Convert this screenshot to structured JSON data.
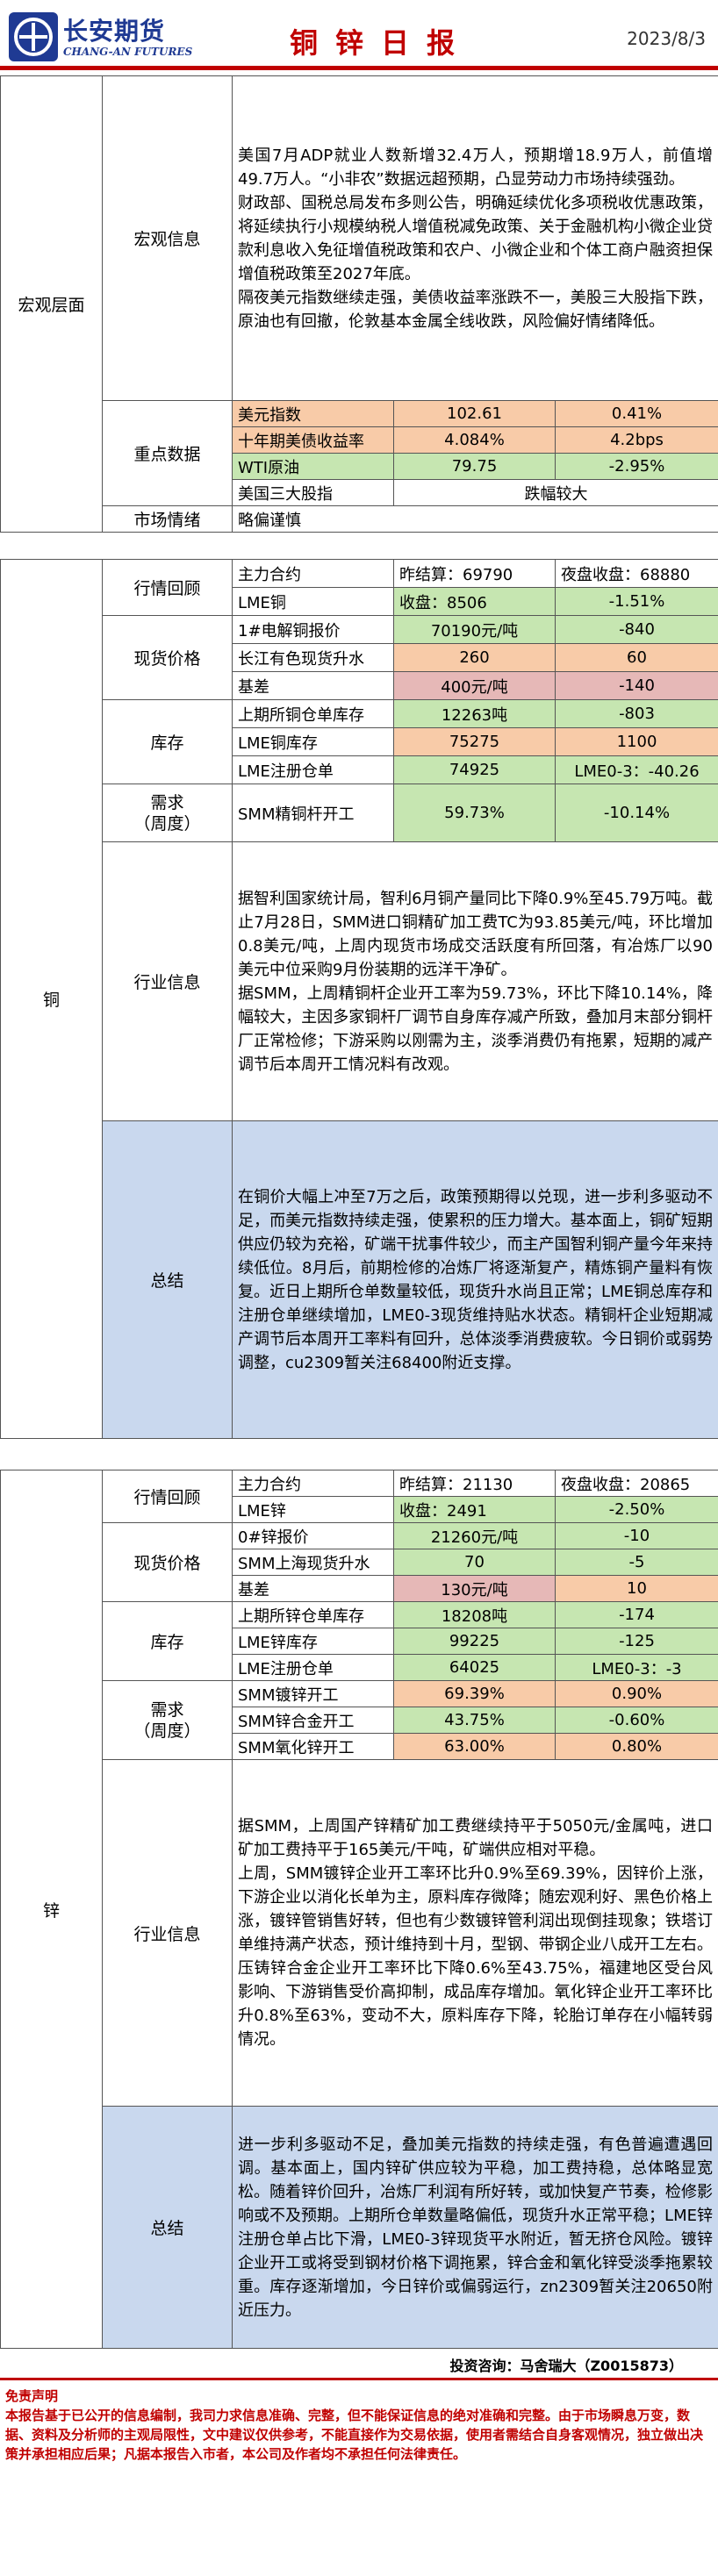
{
  "header": {
    "brand_cn": "长安期货",
    "brand_en": "CHANG-AN FUTURES",
    "title": "铜锌日报",
    "date": "2023/8/3"
  },
  "macro": {
    "section": "宏观层面",
    "info_label": "宏观信息",
    "info_text": "美国7月ADP就业人数新增32.4万人，预期增18.9万人，前值增49.7万人。“小非农”数据远超预期，凸显劳动力市场持续强劲。\n财政部、国税总局发布多则公告，明确延续优化多项税收优惠政策，将延续执行小规模纳税人增值税减免政策、关于金融机构小微企业贷款利息收入免征增值税政策和农户、小微企业和个体工商户融资担保增值税政策至2027年底。\n隔夜美元指数继续走强，美债收益率涨跌不一，美股三大股指下跌，原油也有回撤，伦敦基本金属全线收跌，风险偏好情绪降低。",
    "key_label": "重点数据",
    "rows": [
      {
        "name": "美元指数",
        "v1": "102.61",
        "v2": "0.41%"
      },
      {
        "name": "十年期美债收益率",
        "v1": "4.084%",
        "v2": "4.2bps"
      },
      {
        "name": "WTI原油",
        "v1": "79.75",
        "v2": "-2.95%"
      },
      {
        "name": "美国三大股指",
        "v1": "跌幅较大",
        "v2": ""
      }
    ],
    "sentiment_label": "市场情绪",
    "sentiment": "略偏谨慎"
  },
  "copper": {
    "section": "铜",
    "review_label": "行情回顾",
    "main_contract": "主力合约",
    "main_settle": "昨结算：69790",
    "main_night": "夜盘收盘：68880",
    "lme_name": "LME铜",
    "lme_close": "收盘：8506",
    "lme_chg": "-1.51%",
    "spot_label": "现货价格",
    "spot_rows": [
      {
        "name": "1#电解铜报价",
        "v1": "70190元/吨",
        "v2": "-840"
      },
      {
        "name": "长江有色现货升水",
        "v1": "260",
        "v2": "60"
      },
      {
        "name": "基差",
        "v1": "400元/吨",
        "v2": "-140"
      }
    ],
    "inv_label": "库存",
    "inv_rows": [
      {
        "name": "上期所铜仓单库存",
        "v1": "12263吨",
        "v2": "-803"
      },
      {
        "name": "LME铜库存",
        "v1": "75275",
        "v2": "1100"
      },
      {
        "name": "LME注册仓单",
        "v1": "74925",
        "v2": "LME0-3：-40.26"
      }
    ],
    "demand_label": "需求\n（周度）",
    "demand_row": {
      "name": "SMM精铜杆开工",
      "v1": "59.73%",
      "v2": "-10.14%"
    },
    "industry_label": "行业信息",
    "industry_text": "据智利国家统计局，智利6月铜产量同比下降0.9%至45.79万吨。截止7月28日，SMM进口铜精矿加工费TC为93.85美元/吨，环比增加0.8美元/吨，上周内现货市场成交活跃度有所回落，有冶炼厂以90美元中位采购9月份装期的远洋干净矿。\n据SMM，上周精铜杆企业开工率为59.73%，环比下降10.14%，降幅较大，主因多家铜杆厂调节自身库存减产所致，叠加月末部分铜杆厂正常检修；下游采购以刚需为主，淡季消费仍有拖累，短期的减产调节后本周开工情况料有改观。",
    "summary_label": "总结",
    "summary_text": "在铜价大幅上冲至7万之后，政策预期得以兑现，进一步利多驱动不足，而美元指数持续走强，使累积的压力增大。基本面上，铜矿短期供应仍较为充裕，矿端干扰事件较少，而主产国智利铜产量今年来持续低位。8月后，前期检修的冶炼厂将逐渐复产，精炼铜产量料有恢复。近日上期所仓单数量较低，现货升水尚且正常；LME铜总库存和注册仓单继续增加，LME0-3现货维持贴水状态。精铜杆企业短期减产调节后本周开工率料有回升，总体淡季消费疲软。今日铜价或弱势调整，cu2309暂关注68400附近支撑。"
  },
  "zinc": {
    "section": "锌",
    "review_label": "行情回顾",
    "main_contract": "主力合约",
    "main_settle": "昨结算：21130",
    "main_night": "夜盘收盘：20865",
    "lme_name": "LME锌",
    "lme_close": "收盘：2491",
    "lme_chg": "-2.50%",
    "spot_label": "现货价格",
    "spot_rows": [
      {
        "name": "0#锌报价",
        "v1": "21260元/吨",
        "v2": "-10"
      },
      {
        "name": "SMM上海现货升水",
        "v1": "70",
        "v2": "-5"
      },
      {
        "name": "基差",
        "v1": "130元/吨",
        "v2": "10"
      }
    ],
    "inv_label": "库存",
    "inv_rows": [
      {
        "name": "上期所锌仓单库存",
        "v1": "18208吨",
        "v2": "-174"
      },
      {
        "name": "LME锌库存",
        "v1": "99225",
        "v2": "-125"
      },
      {
        "name": "LME注册仓单",
        "v1": "64025",
        "v2": "LME0-3：-3"
      }
    ],
    "demand_label": "需求\n（周度）",
    "demand_rows": [
      {
        "name": "SMM镀锌开工",
        "v1": "69.39%",
        "v2": "0.90%"
      },
      {
        "name": "SMM锌合金开工",
        "v1": "43.75%",
        "v2": "-0.60%"
      },
      {
        "name": "SMM氧化锌开工",
        "v1": "63.00%",
        "v2": "0.80%"
      }
    ],
    "industry_label": "行业信息",
    "industry_text": "据SMM，上周国产锌精矿加工费继续持平于5050元/金属吨，进口矿加工费持平于165美元/干吨，矿端供应相对平稳。\n上周，SMM镀锌企业开工率环比升0.9%至69.39%，因锌价上涨，下游企业以消化长单为主，原料库存微降；随宏观利好、黑色价格上涨，镀锌管销售好转，但也有少数镀锌管利润出现倒挂现象；铁塔订单维持满产状态，预计维持到十月，型钢、带钢企业八成开工左右。压铸锌合金企业开工率环比下降0.6%至43.75%，福建地区受台风影响、下游销售受价高抑制，成品库存增加。氧化锌企业开工率环比升0.8%至63%，变动不大，原料库存下降，轮胎订单存在小幅转弱情况。",
    "summary_label": "总结",
    "summary_text": "进一步利多驱动不足，叠加美元指数的持续走强，有色普遍遭遇回调。基本面上，国内锌矿供应较为平稳，加工费持稳，总体略显宽松。随着锌价回升，冶炼厂利润有所好转，或加快复产节奏，检修影响或不及预期。上期所仓单数量略偏低，现货升水正常平稳；LME锌注册仓单占比下滑，LME0-3锌现货平水附近，暂无挤仓风险。镀锌企业开工或将受到钢材价格下调拖累，锌合金和氧化锌受淡季拖累较重。库存逐渐增加，今日锌价或偏弱运行，zn2309暂关注20650附近压力。"
  },
  "footer": {
    "signature": "投资咨询：马舍瑞大（Z0015873）",
    "disclaimer_title": "免责声明",
    "disclaimer": "本报告基于已公开的信息编制，我司力求信息准确、完整，但不能保证信息的绝对准确和完整。由于市场瞬息万变，数据、资料及分析师的主观局限性，文中建议仅供参考，不能直接作为交易依据，使用者需结合自身客观情况，独立做出决策并承担相应后果；凡据本报告入市者，本公司及作者均不承担任何法律责任。"
  },
  "colors": {
    "accent": "#c00000",
    "brand": "#1f3a93",
    "green": "#c6e6b1",
    "orange": "#f8cba8",
    "pink": "#e6b8b7",
    "blue": "#c9d8ee"
  }
}
